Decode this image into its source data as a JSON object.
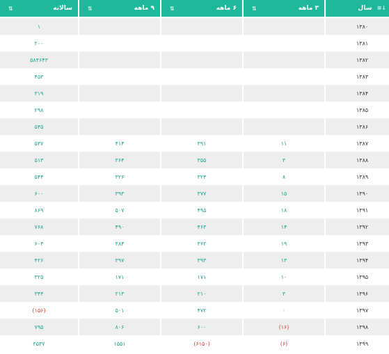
{
  "colors": {
    "header_bg": "#1db99a",
    "value_green": "#1aa58a",
    "value_red": "#e53935",
    "row_alt": "#eeeeee"
  },
  "columns": [
    {
      "key": "year",
      "label": "سال",
      "icon": "sort-asc-icon"
    },
    {
      "key": "m3",
      "label": "۳ ماهه",
      "icon": "sort-icon"
    },
    {
      "key": "m6",
      "label": "۶ ماهه",
      "icon": "sort-icon"
    },
    {
      "key": "m9",
      "label": "۹ ماهه",
      "icon": "sort-icon"
    },
    {
      "key": "yearly",
      "label": "سالانه",
      "icon": "sort-icon"
    }
  ],
  "rows": [
    {
      "year": "۱۳۸۰",
      "m3": "",
      "m6": "",
      "m9": "",
      "yearly": "۱"
    },
    {
      "year": "۱۳۸۱",
      "m3": "",
      "m6": "",
      "m9": "",
      "yearly": "۲۰۰"
    },
    {
      "year": "۱۳۸۲",
      "m3": "",
      "m6": "",
      "m9": "",
      "yearly": "۵۸۴۶۴۳"
    },
    {
      "year": "۱۳۸۳",
      "m3": "",
      "m6": "",
      "m9": "",
      "yearly": "۴۵۳"
    },
    {
      "year": "۱۳۸۴",
      "m3": "",
      "m6": "",
      "m9": "",
      "yearly": "۳۱۹"
    },
    {
      "year": "۱۳۸۵",
      "m3": "",
      "m6": "",
      "m9": "",
      "yearly": "۲۹۸"
    },
    {
      "year": "۱۳۸۶",
      "m3": "",
      "m6": "",
      "m9": "",
      "yearly": "۵۴۵"
    },
    {
      "year": "۱۳۸۷",
      "m3": "۱۱",
      "m6": "۳۹۱",
      "m9": "۴۱۴",
      "yearly": "۵۳۷"
    },
    {
      "year": "۱۳۸۸",
      "m3": "۳",
      "m6": "۳۵۵",
      "m9": "۳۶۴",
      "yearly": "۵۱۳"
    },
    {
      "year": "۱۳۸۹",
      "m3": "۸",
      "m6": "۳۲۴",
      "m9": "۳۲۶",
      "yearly": "۵۴۴"
    },
    {
      "year": "۱۳۹۰",
      "m3": "۱۵",
      "m6": "۳۷۷",
      "m9": "۳۹۳",
      "yearly": "۶۰۰"
    },
    {
      "year": "۱۳۹۱",
      "m3": "۱۸",
      "m6": "۴۹۵",
      "m9": "۵۰۷",
      "yearly": "۸۶۹"
    },
    {
      "year": "۱۳۹۲",
      "m3": "۱۴",
      "m6": "۴۶۳",
      "m9": "۴۹۰",
      "yearly": "۷۶۸"
    },
    {
      "year": "۱۳۹۳",
      "m3": "۱۹",
      "m6": "۳۶۲",
      "m9": "۳۸۴",
      "yearly": "۶۰۴"
    },
    {
      "year": "۱۳۹۴",
      "m3": "۱۳",
      "m6": "۳۹۳",
      "m9": "۳۹۷",
      "yearly": "۴۲۶"
    },
    {
      "year": "۱۳۹۵",
      "m3": "۱۰",
      "m6": "۱۷۱",
      "m9": "۱۷۱",
      "yearly": "۳۲۵"
    },
    {
      "year": "۱۳۹۶",
      "m3": "۳",
      "m6": "۲۱۰",
      "m9": "۲۱۳",
      "yearly": "۳۴۴"
    },
    {
      "year": "۱۳۹۷",
      "m3": "۰",
      "m6": "۴۷۲",
      "m9": "۵۰۱",
      "yearly": "(۱۵۶)"
    },
    {
      "year": "۱۳۹۸",
      "m3": "(۱۶)",
      "m6": "۶۰۰",
      "m9": "۸۰۶",
      "yearly": "۷۹۵"
    },
    {
      "year": "۱۳۹۹",
      "m3": "(۶)",
      "m6": "(۶۱۵۰)",
      "m9": "۱۵۵۱",
      "yearly": "۳۵۳۷"
    }
  ]
}
